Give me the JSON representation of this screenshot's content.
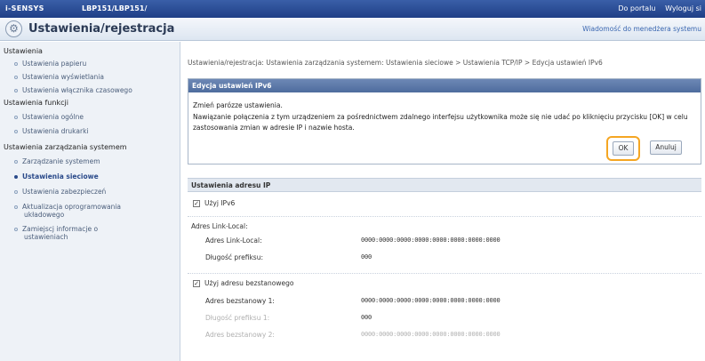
{
  "topbar": {
    "brand": "i-SENSYS",
    "model": "LBP151/LBP151/",
    "link_portal": "Do portalu",
    "link_logout": "Wyloguj si"
  },
  "titlebar": {
    "title": "Ustawienia/rejestracja",
    "mail": "Wiadomość do menedżera systemu"
  },
  "sidebar": {
    "head1": "Ustawienia",
    "items1": [
      "Ustawienia papieru",
      "Ustawienia wyświetlania",
      "Ustawienia włącznika czasowego"
    ],
    "head2": "Ustawienia funkcji",
    "items2": [
      "Ustawienia ogólne",
      "Ustawienia drukarki"
    ],
    "head3": "Ustawienia zarządzania systemem",
    "items3": [
      "Zarządzanie systemem",
      "Ustawienia sieciowe",
      "Ustawienia zabezpieczeń"
    ],
    "item_update_line1": "Aktualizacja oprogramowania",
    "item_update_line2": "układowego",
    "item_import_line1": "Zamiejscj informacje o",
    "item_import_line2": "ustawieniach"
  },
  "breadcrumb": "Ustawienia/rejestracja: Ustawienia zarządzania systemem: Ustawienia sieciowe > Ustawienia TCP/IP > Edycja ustawień IPv6",
  "dialog": {
    "title": "Edycja ustawień IPv6",
    "msg1": "Zmień parózze ustawienia.",
    "msg2": "Nawiązanie połączenia z tym urządzeniem za pośrednictwem zdalnego interfejsu użytkownika może się nie udać po kliknięciu przycisku [OK] w celu zastosowania zmian w adresie IP i nazwie hosta.",
    "ok_label": "OK",
    "cancel_label": "Anuluj"
  },
  "section": {
    "title": "Ustawienia adresu IP",
    "use_ipv6": "Użyj IPv6",
    "use_ipv6_checked": true,
    "link_local_head": "Adres Link-Local:",
    "link_local_label": "Adres Link-Local:",
    "link_local_value": "0000:0000:0000:0000:0000:0000:0000:0000",
    "prefix_label": "Długość prefiksu:",
    "prefix_value": "000",
    "stateless_checkbox": "Użyj adresu bezstanowego",
    "stateless_checked": true,
    "stateless1_label": "Adres bezstanowy 1:",
    "stateless1_value": "0000:0000:0000:0000:0000:0000:0000:0000",
    "prefix1_label": "Długość prefiksu 1:",
    "prefix1_value": "000",
    "stateless2_label": "Adres bezstanowy 2:",
    "stateless2_value": "0000:0000:0000:0000:0000:0000:0000:0000"
  },
  "colors": {
    "topbar": "#1f3f86",
    "accent_highlight": "#f5a623",
    "dialog_header": "#4e6c9e"
  }
}
